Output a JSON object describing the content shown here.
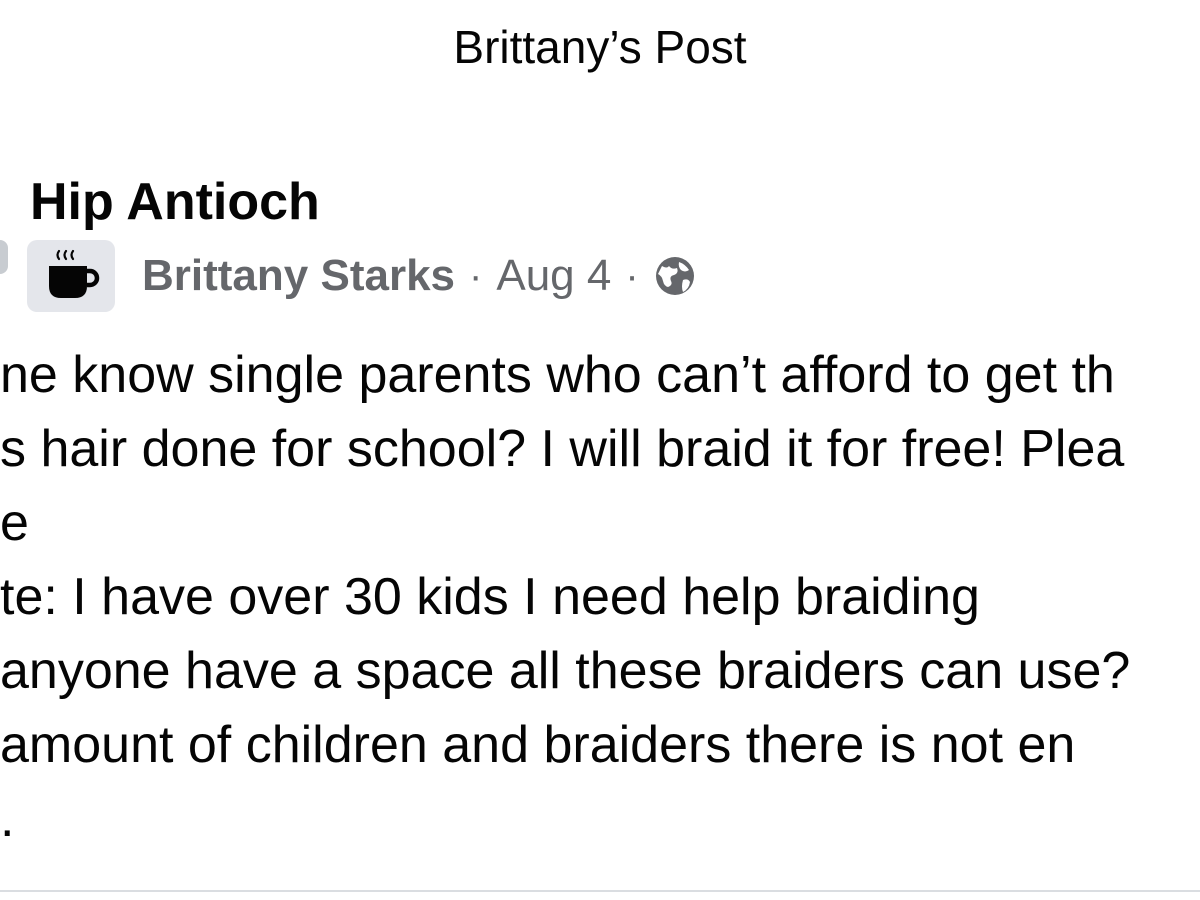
{
  "header": {
    "title": "Brittany’s Post"
  },
  "post": {
    "group_name": "Hip Antioch",
    "author": "Brittany Starks",
    "separator": "·",
    "date": "Aug 4",
    "avatar_icon": "coffee-cup-icon",
    "privacy_icon": "globe-icon",
    "lines": [
      "ne know single parents who can’t afford to get th",
      "s hair done for school? I will braid it for free! Plea",
      "e",
      "te: I have over 30 kids I need help braiding",
      "anyone have a space all these braiders can use?",
      " amount of children and braiders there is not en",
      "."
    ]
  },
  "colors": {
    "text_primary": "#050505",
    "text_secondary": "#65676b",
    "avatar_bg": "#e4e6eb",
    "divider": "#dadde1"
  }
}
